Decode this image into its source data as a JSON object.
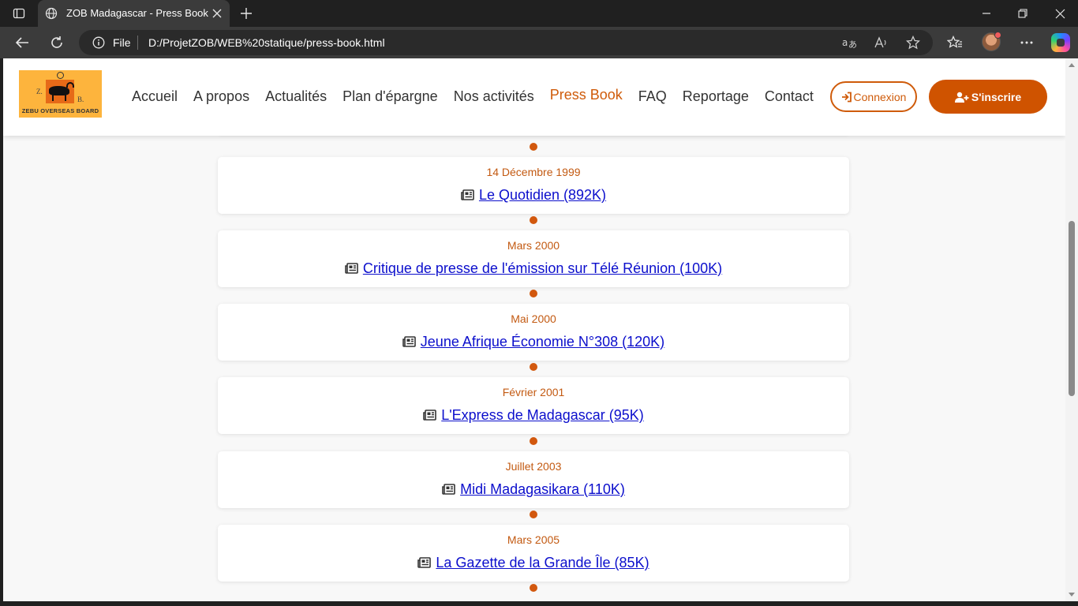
{
  "browser": {
    "tab_title": "ZOB Madagascar - Press Book",
    "address_scheme": "File",
    "url": "D:/ProjetZOB/WEB%20statique/press-book.html"
  },
  "site": {
    "logo": {
      "letter_z": "Z.",
      "letter_b": "B.",
      "caption": "ZEBU OVERSEAS BOARD"
    },
    "nav": [
      {
        "label": "Accueil"
      },
      {
        "label": "A propos"
      },
      {
        "label": "Actualités"
      },
      {
        "label": "Plan d'épargne"
      },
      {
        "label": "Nos activités"
      },
      {
        "label": "Press Book",
        "active": true
      },
      {
        "label": "FAQ"
      },
      {
        "label": "Reportage"
      },
      {
        "label": "Contact"
      }
    ],
    "login_label": "Connexion",
    "signup_label": "S'inscrire",
    "accent_color": "#cf5b0a"
  },
  "press_items": [
    {
      "date": "14 Décembre 1999",
      "title": "Le Quotidien (892K)"
    },
    {
      "date": "Mars 2000",
      "title": "Critique de presse de l'émission sur Télé Réunion (100K)"
    },
    {
      "date": "Mai 2000",
      "title": "Jeune Afrique Économie N°308 (120K)"
    },
    {
      "date": "Février 2001",
      "title": "L'Express de Madagascar (95K)"
    },
    {
      "date": "Juillet 2003",
      "title": "Midi Madagasikara (110K)"
    },
    {
      "date": "Mars 2005",
      "title": "La Gazette de la Grande Île (85K)"
    }
  ]
}
